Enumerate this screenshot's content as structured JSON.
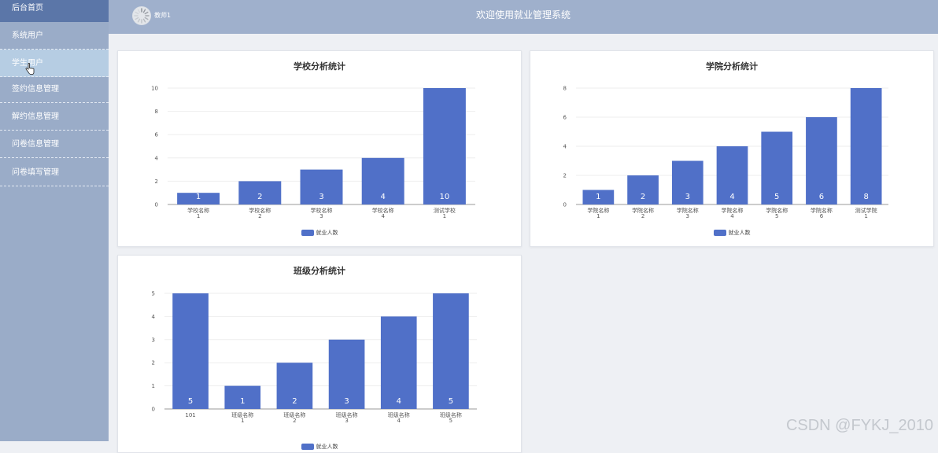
{
  "sidebar": {
    "items": [
      {
        "label": "后台首页"
      },
      {
        "label": "系统用户"
      },
      {
        "label": "学生用户"
      },
      {
        "label": "签约信息管理"
      },
      {
        "label": "解约信息管理"
      },
      {
        "label": "问卷信息管理"
      },
      {
        "label": "问卷填写管理"
      }
    ],
    "active_index": 2
  },
  "header": {
    "title": "欢迎使用就业管理系统",
    "user_name": "教师1"
  },
  "colors": {
    "accent": "#5070c8",
    "header": "#9fb0cc",
    "sidebar": "#9aacc8"
  },
  "charts": {
    "school": {
      "title": "学校分析统计",
      "legend_label": "就业人数"
    },
    "college": {
      "title": "学院分析统计",
      "legend_label": "就业人数"
    },
    "class": {
      "title": "班级分析统计",
      "legend_label": "就业人数"
    }
  },
  "chart_data": [
    {
      "type": "bar",
      "title": "学校分析统计",
      "categories": [
        "学校名称1",
        "学校名称2",
        "学校名称3",
        "学校名称4",
        "测试学校1"
      ],
      "series": [
        {
          "name": "就业人数",
          "values": [
            1,
            2,
            3,
            4,
            10
          ]
        }
      ],
      "ylim": [
        0,
        10
      ],
      "yticks": [
        0,
        2,
        4,
        6,
        8,
        10
      ],
      "grid": true,
      "legend": "bottom"
    },
    {
      "type": "bar",
      "title": "学院分析统计",
      "categories": [
        "学院名称1",
        "学院名称2",
        "学院名称3",
        "学院名称4",
        "学院名称5",
        "学院名称6",
        "测试学院1"
      ],
      "series": [
        {
          "name": "就业人数",
          "values": [
            1,
            2,
            3,
            4,
            5,
            6,
            8
          ]
        }
      ],
      "ylim": [
        0,
        8
      ],
      "yticks": [
        0,
        2,
        4,
        6,
        8
      ],
      "grid": true,
      "legend": "bottom"
    },
    {
      "type": "bar",
      "title": "班级分析统计",
      "categories": [
        "101",
        "班级名称1",
        "班级名称2",
        "班级名称3",
        "班级名称4",
        "班级名称5"
      ],
      "series": [
        {
          "name": "就业人数",
          "values": [
            5,
            1,
            2,
            3,
            4,
            5
          ]
        }
      ],
      "ylim": [
        0,
        5
      ],
      "yticks": [
        0,
        1,
        2,
        3,
        4,
        5
      ],
      "grid": true,
      "legend": "bottom"
    }
  ],
  "watermark": "CSDN @FYKJ_2010"
}
